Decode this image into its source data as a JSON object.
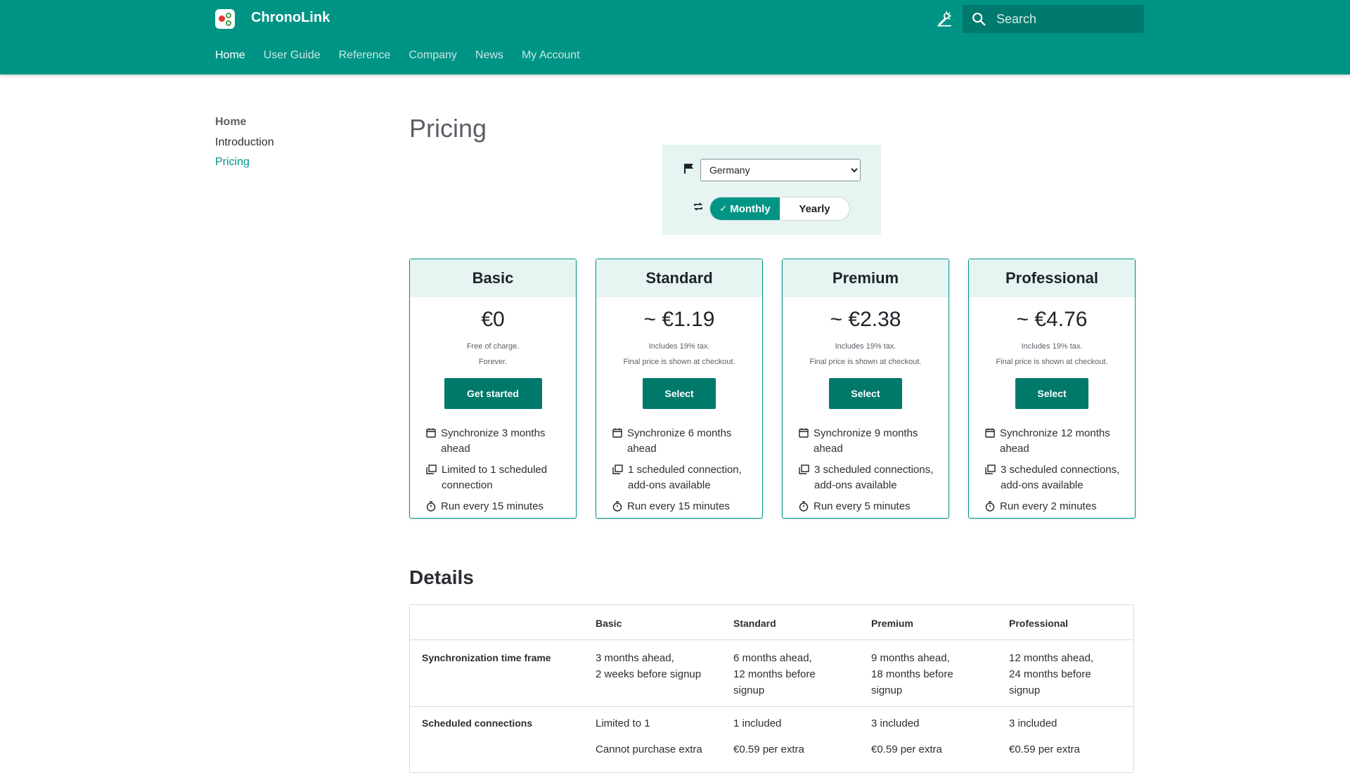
{
  "header": {
    "brand": "ChronoLink",
    "search_placeholder": "Search",
    "tabs": [
      "Home",
      "User Guide",
      "Reference",
      "Company",
      "News",
      "My Account"
    ]
  },
  "sidebar": {
    "title": "Home",
    "items": [
      "Introduction",
      "Pricing"
    ]
  },
  "page": {
    "title": "Pricing"
  },
  "selector": {
    "country": "Germany",
    "monthly": "Monthly",
    "yearly": "Yearly"
  },
  "plans": [
    {
      "name": "Basic",
      "price": "€0",
      "note1": "Free of charge.",
      "note2": "Forever.",
      "button": "Get started",
      "f1": "Synchronize 3 months ahead",
      "f2": "Limited to 1 scheduled connection",
      "f3": "Run every 15 minutes"
    },
    {
      "name": "Standard",
      "price": "~ €1.19",
      "note1": "Includes 19% tax.",
      "note2": "Final price is shown at checkout.",
      "button": "Select",
      "f1": "Synchronize 6 months ahead",
      "f2": "1 scheduled connection, add-ons available",
      "f3": "Run every 15 minutes"
    },
    {
      "name": "Premium",
      "price": "~ €2.38",
      "note1": "Includes 19% tax.",
      "note2": "Final price is shown at checkout.",
      "button": "Select",
      "f1": "Synchronize 9 months ahead",
      "f2": "3 scheduled connections, add-ons available",
      "f3": "Run every 5 minutes"
    },
    {
      "name": "Professional",
      "price": "~ €4.76",
      "note1": "Includes 19% tax.",
      "note2": "Final price is shown at checkout.",
      "button": "Select",
      "f1": "Synchronize 12 months ahead",
      "f2": "3 scheduled connections, add-ons available",
      "f3": "Run every 2 minutes"
    }
  ],
  "details": {
    "title": "Details",
    "headers": [
      "Basic",
      "Standard",
      "Premium",
      "Professional"
    ],
    "rows": [
      {
        "label": "Synchronization time frame",
        "cells": [
          "3 months ahead,\n2 weeks before signup",
          "6 months ahead,\n12 months before\nsignup",
          "9 months ahead,\n18 months before\nsignup",
          "12 months ahead,\n24 months before\nsignup"
        ]
      },
      {
        "label": "Scheduled connections",
        "cells": [
          "Limited to 1",
          "1 included",
          "3 included",
          "3 included"
        ],
        "extras": [
          "Cannot purchase extra",
          "€0.59 per extra",
          "€0.59 per extra",
          "€0.59 per extra"
        ]
      }
    ]
  }
}
